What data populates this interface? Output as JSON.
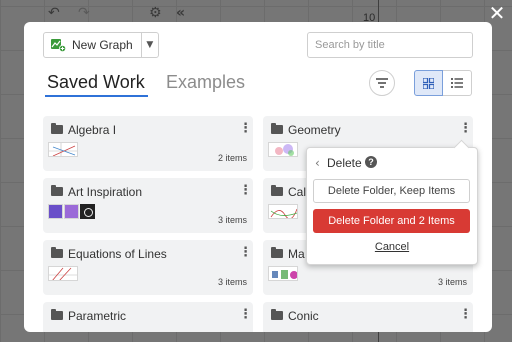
{
  "background": {
    "undo_icon": "undo-arrow-icon",
    "redo_icon": "redo-arrow-icon",
    "settings_icon": "gear-icon",
    "collapse_icon": "double-chevron-left-icon",
    "axis_label": "10",
    "close_icon": "close-x-icon"
  },
  "toolbar": {
    "new_graph_label": "New Graph",
    "search_placeholder": "Search by title"
  },
  "tabs": [
    {
      "label": "Saved Work",
      "active": true
    },
    {
      "label": "Examples",
      "active": false
    }
  ],
  "view": {
    "mode": "grid"
  },
  "folders": [
    {
      "name": "Algebra I",
      "count": "2 items"
    },
    {
      "name": "Geometry",
      "count": ""
    },
    {
      "name": "Art Inspiration",
      "count": "3 items"
    },
    {
      "name": "Cal",
      "count": ""
    },
    {
      "name": "Equations of Lines",
      "count": "3 items"
    },
    {
      "name": "Ma",
      "count": "3 items"
    },
    {
      "name": "Parametric",
      "count": ""
    },
    {
      "name": "Conic",
      "count": ""
    }
  ],
  "popover": {
    "title": "Delete",
    "keep_items_label": "Delete Folder, Keep Items",
    "delete_all_label": "Delete Folder and 2 Items",
    "cancel_label": "Cancel"
  },
  "colors": {
    "accent": "#2f72d8",
    "danger": "#d83a34",
    "card_bg": "#f1f2f3"
  }
}
